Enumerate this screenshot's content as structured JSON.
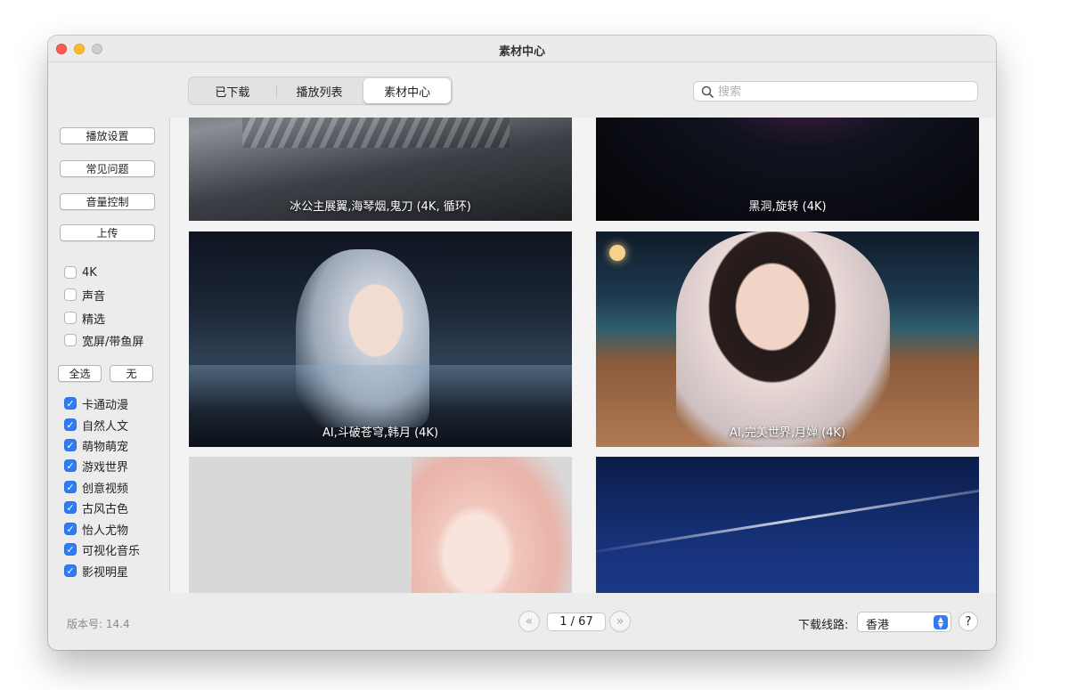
{
  "window": {
    "title": "素材中心"
  },
  "tabs": [
    {
      "label": "已下载",
      "active": false
    },
    {
      "label": "播放列表",
      "active": false
    },
    {
      "label": "素材中心",
      "active": true
    }
  ],
  "search": {
    "placeholder": "搜索",
    "value": ""
  },
  "sidebar": {
    "buttons": [
      "播放设置",
      "常见问题",
      "音量控制",
      "上传"
    ],
    "filters": [
      {
        "label": "4K",
        "checked": false
      },
      {
        "label": "声音",
        "checked": false
      },
      {
        "label": "精选",
        "checked": false
      },
      {
        "label": "宽屏/带鱼屏",
        "checked": false
      }
    ],
    "select_all_label": "全选",
    "select_none_label": "无",
    "categories": [
      {
        "label": "卡通动漫",
        "checked": true
      },
      {
        "label": "自然人文",
        "checked": true
      },
      {
        "label": "萌物萌宠",
        "checked": true
      },
      {
        "label": "游戏世界",
        "checked": true
      },
      {
        "label": "创意视频",
        "checked": true
      },
      {
        "label": "古风古色",
        "checked": true
      },
      {
        "label": "怡人尤物",
        "checked": true
      },
      {
        "label": "可视化音乐",
        "checked": true
      },
      {
        "label": "影视明星",
        "checked": true
      }
    ]
  },
  "gallery": [
    {
      "caption": "冰公主展翼,海琴烟,鬼刀 (4K, 循环)"
    },
    {
      "caption": "黑洞,旋转 (4K)"
    },
    {
      "caption": "AI,斗破苍穹,韩月 (4K)"
    },
    {
      "caption": "AI,完美世界,月婵 (4K)"
    },
    {
      "caption": ""
    },
    {
      "caption": ""
    }
  ],
  "footer": {
    "version": "版本号: 14.4",
    "prev_icon": "«",
    "next_icon": "»",
    "page": "1 / 67",
    "route_label": "下载线路:",
    "route_value": "香港",
    "help_label": "?"
  },
  "colors": {
    "accent": "#2f7cf6",
    "window_bg": "#ececec"
  }
}
